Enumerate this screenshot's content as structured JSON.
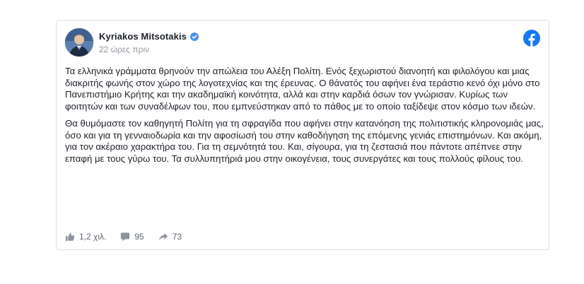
{
  "post": {
    "author": "Kyriakos Mitsotakis",
    "verified": true,
    "timestamp": "22 ώρες πριν",
    "paragraphs": [
      "Τα ελληνικά γράμματα θρηνούν την απώλεια του Αλέξη Πολίτη. Ενός ξεχωριστού διανοητή και φιλολόγου και μιας διακριτής φωνής στον χώρο της λογοτεχνίας και της έρευνας. Ο θάνατός του αφήνει ένα τεράστιο κενό όχι μόνο στο Πανεπιστήμιο Κρήτης και την ακαδημαϊκή κοινότητα, αλλά και στην καρδιά όσων τον γνώρισαν. Κυρίως των φοιτητών και των συναδέλφων του, που εμπνεύστηκαν από το πάθος με το οποίο ταξίδεψε στον κόσμο των ιδεών.",
      "Θα θυμόμαστε τον καθηγητή Πολίτη για τη σφραγίδα που αφήνει στην κατανόηση της πολιτιστικής κληρονομιάς μας, όσο και για τη γενναιοδωρία και την αφοσίωσή του στην καθοδήγηση της επόμενης γενιάς επιστημόνων. Και ακόμη, για τον ακέραιο χαρακτήρα του. Για τη σεμνότητά του. Και, σίγουρα, για τη ζεστασιά που πάντοτε απέπνεε στην επαφή με τους γύρω του. Τα συλλυπητήριά μου στην οικογένεια, τους συνεργάτες και τους πολλούς φίλους του."
    ],
    "stats": {
      "likes": "1,2 χιλ.",
      "comments": "95",
      "shares": "73"
    }
  },
  "icons": {
    "brand": "facebook-icon",
    "verified": "verified-badge-icon",
    "like": "thumbs-up-icon",
    "comment": "comment-icon",
    "share": "share-arrow-icon"
  },
  "colors": {
    "facebook_blue": "#1877f2",
    "text": "#1d2129",
    "meta_gray": "#90949c",
    "stat_gray": "#606770",
    "card_border": "#dddfe2"
  }
}
